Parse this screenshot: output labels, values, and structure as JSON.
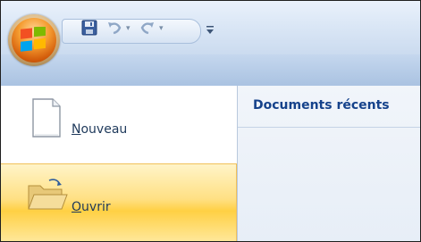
{
  "office_button": {
    "icon": "office-logo-icon"
  },
  "quick_access": {
    "save": {
      "icon": "save-icon"
    },
    "undo": {
      "icon": "undo-icon"
    },
    "redo": {
      "icon": "redo-icon"
    },
    "customize": {
      "icon": "customize-qat-icon"
    }
  },
  "menu": {
    "new_label": "Nouveau",
    "new_accel": "N",
    "new_rest": "ouveau",
    "open_label": "Ouvrir",
    "open_accel": "O",
    "open_rest": "uvrir"
  },
  "recent": {
    "title": "Documents récents"
  },
  "colors": {
    "orb": "#f59b2f",
    "highlight": "#ffd044",
    "recent_title": "#15428b",
    "label": "#1e395b"
  }
}
